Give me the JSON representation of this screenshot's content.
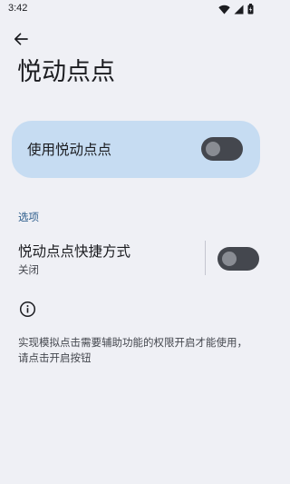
{
  "status_bar": {
    "time": "3:42",
    "icons": [
      "wifi-icon",
      "cellular-signal-icon",
      "battery-charging-icon"
    ]
  },
  "header": {
    "back_icon": "arrow-back-icon",
    "title": "悦动点点"
  },
  "master_switch": {
    "label": "使用悦动点点",
    "on": false
  },
  "options_section": {
    "header": "选项",
    "shortcut": {
      "title": "悦动点点快捷方式",
      "summary": "关闭",
      "on": false
    }
  },
  "footer": {
    "icon": "info-icon",
    "text": "实现模拟点击需要辅助功能的权限开启才能使用，请点击开启按钮"
  },
  "colors": {
    "background": "#eff0f5",
    "card": "#c6dcf2",
    "switch_track_off": "#44474e",
    "switch_knob_off": "#898c93",
    "section_accent": "#2d5d8b"
  }
}
